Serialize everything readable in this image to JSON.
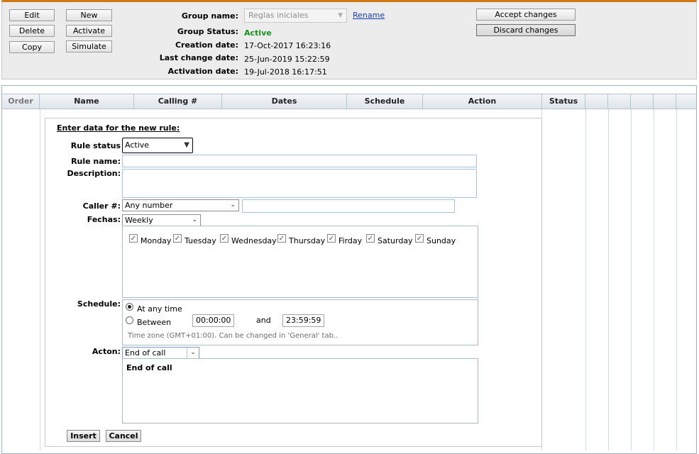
{
  "toolbar": {
    "edit": "Edit",
    "delete": "Delete",
    "copy": "Copy",
    "new": "New",
    "activate": "Activate",
    "simulate": "Simulate",
    "accept": "Accept changes",
    "discard": "Discard changes"
  },
  "group": {
    "name_label": "Group name:",
    "name_value": "Reglas iniciales",
    "rename": "Rename",
    "status_label": "Group Status:",
    "status_value": "Active",
    "creation_label": "Creation date:",
    "creation_value": "17-Oct-2017 16:23:16",
    "lastchange_label": "Last change date:",
    "lastchange_value": "25-Jun-2019 15:22:59",
    "activation_label": "Activation date:",
    "activation_value": "19-Jul-2018 16:17:51"
  },
  "table": {
    "headers": [
      "Order",
      "Name",
      "Calling #",
      "Dates",
      "Schedule",
      "Action",
      "Status"
    ]
  },
  "form": {
    "title": "Enter data for the new rule:",
    "rule_status_label": "Rule status",
    "rule_status_value": "Active",
    "rule_name_label": "Rule name:",
    "rule_name_value": "",
    "description_label": "Description:",
    "description_value": "",
    "caller_label": "Caller #:",
    "caller_value": "Any number",
    "caller_number_value": "",
    "fechas_label": "Fechas:",
    "fechas_value": "Weekly",
    "days": [
      "Monday",
      "Tuesday",
      "Wednesday",
      "Thursday",
      "Firday",
      "Saturday",
      "Sunday"
    ],
    "schedule_label": "Schedule:",
    "schedule_any": "At any time",
    "schedule_between": "Between",
    "time_from": "00:00:00",
    "time_and": "and",
    "time_to": "23:59:59",
    "timezone_note": "Time zone (GMT+01:00). Can be changed in 'General' tab..",
    "action_label": "Acton:",
    "action_value": "End of call",
    "action_detail": "End of call",
    "insert": "Insert",
    "cancel": "Cancel"
  },
  "colors": {
    "accent_bar": "#d07a17",
    "status_active": "#17941b",
    "link": "#1a3ea8"
  }
}
